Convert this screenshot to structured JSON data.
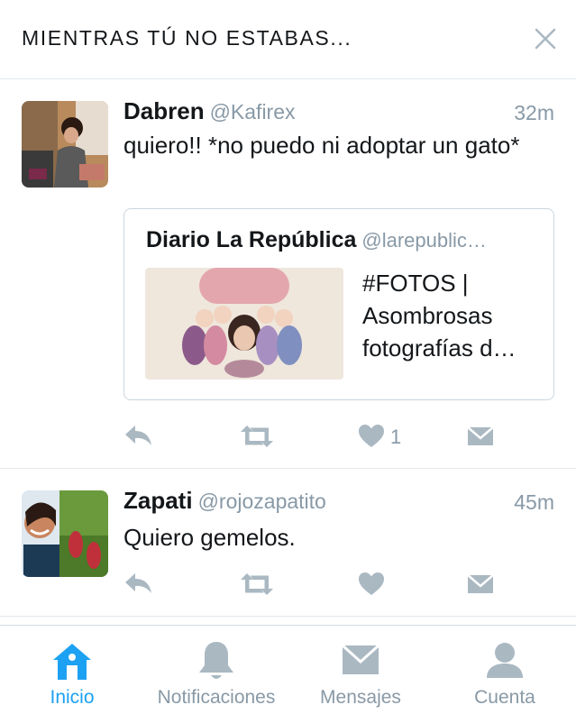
{
  "header": {
    "title": "MIENTRAS TÚ NO ESTABAS..."
  },
  "tweets": [
    {
      "display_name": "Dabren",
      "handle": "@Kafirex",
      "time": "32m",
      "text": "quiero!! *no puedo ni adoptar un gato*",
      "quote": {
        "name": "Diario La República",
        "handle": "@larepublic…",
        "text": "#FOTOS | Asombrosas fotografías d…"
      },
      "like_count": "1"
    },
    {
      "display_name": "Zapati",
      "handle": "@rojozapatito",
      "time": "45m",
      "text": "Quiero gemelos."
    }
  ],
  "tabs": [
    {
      "label": "Inicio",
      "active": true,
      "icon": "home-icon"
    },
    {
      "label": "Notificaciones",
      "active": false,
      "icon": "bell-icon"
    },
    {
      "label": "Mensajes",
      "active": false,
      "icon": "envelope-icon"
    },
    {
      "label": "Cuenta",
      "active": false,
      "icon": "person-icon"
    }
  ],
  "colors": {
    "accent": "#1da1f2",
    "icon_gray": "#aab8c2",
    "secondary_text": "#8899a6",
    "divider": "#e1e8ed"
  }
}
